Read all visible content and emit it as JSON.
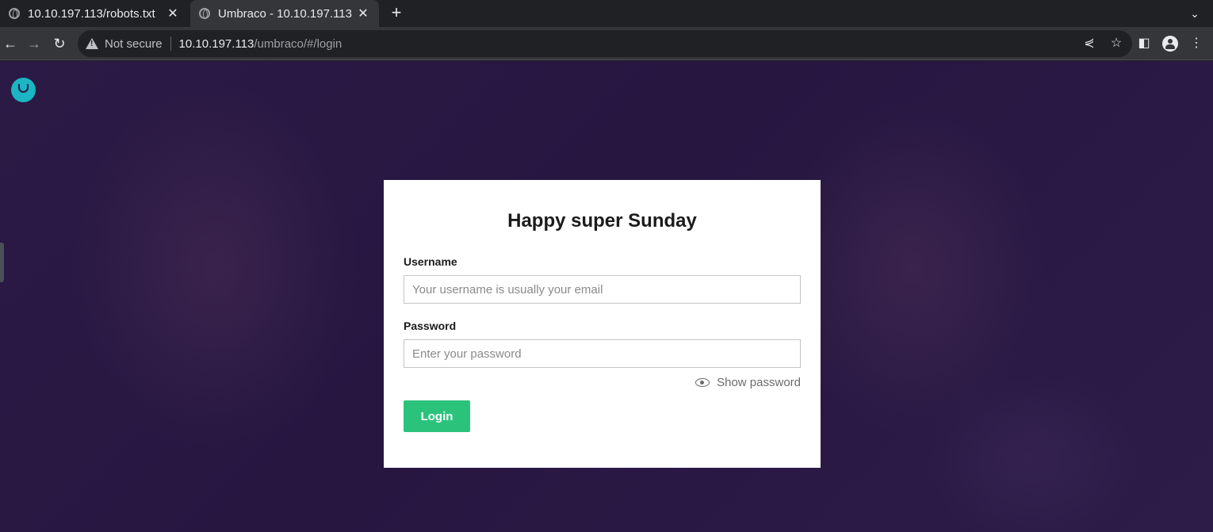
{
  "browser": {
    "tabs": [
      {
        "title": "10.10.197.113/robots.txt",
        "active": false
      },
      {
        "title": "Umbraco - 10.10.197.113",
        "active": true
      }
    ],
    "new_tab_label": "+",
    "address": {
      "security_label": "Not secure",
      "host": "10.10.197.113",
      "path": "/umbraco/#/login"
    },
    "icons": [
      "globe-icon",
      "close-icon",
      "back-icon",
      "forward-icon",
      "reload-icon",
      "warning-icon",
      "share-icon",
      "star-icon",
      "side-panel-icon",
      "profile-icon",
      "menu-icon",
      "tab-search-icon"
    ]
  },
  "page": {
    "logo": "umbraco-logo",
    "login": {
      "greeting": "Happy super Sunday",
      "username_label": "Username",
      "username_placeholder": "Your username is usually your email",
      "username_value": "",
      "password_label": "Password",
      "password_placeholder": "Enter your password",
      "password_value": "",
      "show_password_label": "Show password",
      "login_button": "Login"
    },
    "colors": {
      "accent": "#2bc37c",
      "logo": "#1bb5c4",
      "background": "#2b1a45"
    }
  }
}
